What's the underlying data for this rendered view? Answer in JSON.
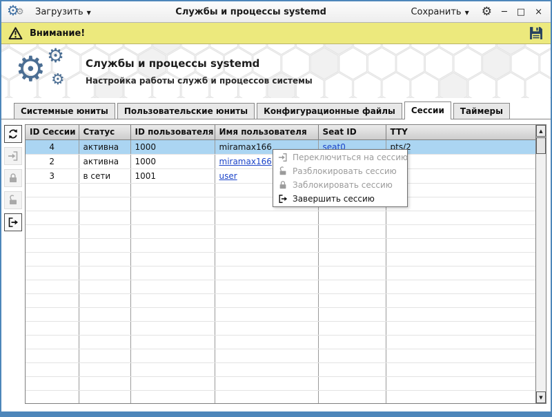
{
  "colors": {
    "frame": "#4d86ba",
    "warning_bg": "#ece97d",
    "selection": "#abd5f2",
    "link": "#1a43c8",
    "logo": "#4b6e93"
  },
  "icons": {
    "gear": "⚙",
    "dropdown_arrow": "▼",
    "minimize": "─",
    "maximize": "□",
    "close": "×",
    "scroll_up": "▲",
    "scroll_down": "▼"
  },
  "titlebar": {
    "load_label": "Загрузить",
    "title": "Службы и процессы systemd",
    "save_label": "Сохранить"
  },
  "warning_bar": {
    "label": "Внимание!"
  },
  "hero": {
    "title": "Службы и процессы systemd",
    "subtitle": "Настройка работы служб и процессов системы"
  },
  "tabs": [
    {
      "label": "Системные юниты",
      "active": false
    },
    {
      "label": "Пользовательские юниты",
      "active": false
    },
    {
      "label": "Конфигурационные файлы",
      "active": false
    },
    {
      "label": "Сессии",
      "active": true
    },
    {
      "label": "Таймеры",
      "active": false
    }
  ],
  "toolbar": [
    {
      "name": "refresh",
      "icon": "refresh-icon",
      "enabled": true
    },
    {
      "name": "switch-to-session",
      "icon": "switch-session-icon",
      "enabled": false
    },
    {
      "name": "lock-session",
      "icon": "lock-icon",
      "enabled": false
    },
    {
      "name": "unlock-session",
      "icon": "unlock-icon",
      "enabled": false
    },
    {
      "name": "terminate-session",
      "icon": "exit-icon",
      "enabled": true
    }
  ],
  "table": {
    "columns": [
      "ID Сессии",
      "Статус",
      "ID пользователя",
      "Имя пользователя",
      "Seat ID",
      "TTY"
    ],
    "rows": [
      {
        "cells": [
          "4",
          "активна",
          "1000",
          "miramax166",
          "seat0",
          "pts/2"
        ],
        "selected": true,
        "links": [
          4
        ]
      },
      {
        "cells": [
          "2",
          "активна",
          "1000",
          "miramax166",
          "",
          ""
        ],
        "selected": false,
        "links": [
          3
        ]
      },
      {
        "cells": [
          "3",
          "в сети",
          "1001",
          "user",
          "",
          ""
        ],
        "selected": false,
        "links": [
          3
        ]
      }
    ],
    "empty_row_count": 16
  },
  "context_menu": {
    "items": [
      {
        "label": "Переключиться на сессию",
        "icon": "switch-session-icon",
        "enabled": false
      },
      {
        "label": "Разблокировать сессию",
        "icon": "unlock-icon",
        "enabled": false
      },
      {
        "label": "Заблокировать сессию",
        "icon": "lock-icon",
        "enabled": false
      },
      {
        "label": "Завершить сессию",
        "icon": "exit-icon",
        "enabled": true
      }
    ]
  }
}
